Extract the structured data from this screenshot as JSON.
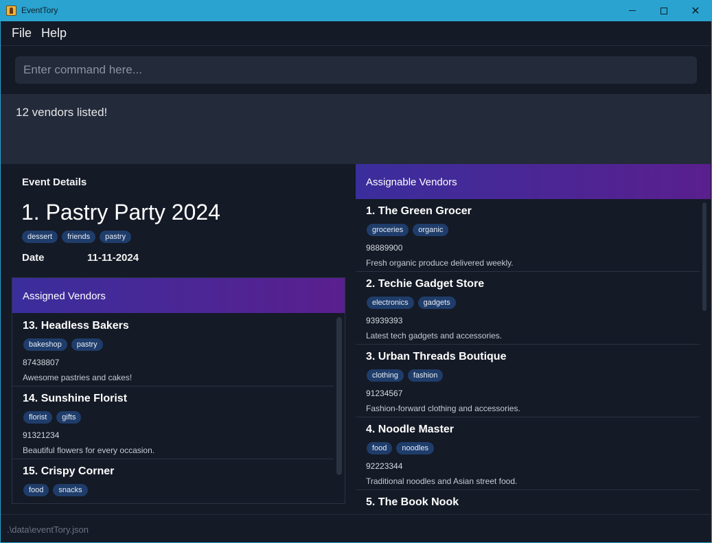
{
  "window": {
    "title": "EventTory"
  },
  "menu": {
    "file": "File",
    "help": "Help"
  },
  "command": {
    "placeholder": "Enter command here..."
  },
  "result": {
    "message": "12 vendors listed!"
  },
  "event": {
    "heading": "Event Details",
    "name": "1. Pastry Party 2024",
    "tags": [
      "dessert",
      "friends",
      "pastry"
    ],
    "date_label": "Date",
    "date_value": "11-11-2024"
  },
  "assigned": {
    "header": "Assigned Vendors",
    "vendors": [
      {
        "name": "13. Headless Bakers",
        "tags": [
          "bakeshop",
          "pastry"
        ],
        "phone": "87438807",
        "description": "Awesome pastries and cakes!"
      },
      {
        "name": "14. Sunshine Florist",
        "tags": [
          "florist",
          "gifts"
        ],
        "phone": "91321234",
        "description": "Beautiful flowers for every occasion."
      },
      {
        "name": "15. Crispy Corner",
        "tags": [
          "food",
          "snacks"
        ],
        "phone": "",
        "description": ""
      }
    ]
  },
  "assignable": {
    "header": "Assignable Vendors",
    "vendors": [
      {
        "name": "1. The Green Grocer",
        "tags": [
          "groceries",
          "organic"
        ],
        "phone": "98889900",
        "description": "Fresh organic produce delivered weekly."
      },
      {
        "name": "2. Techie Gadget Store",
        "tags": [
          "electronics",
          "gadgets"
        ],
        "phone": "93939393",
        "description": "Latest tech gadgets and accessories."
      },
      {
        "name": "3. Urban Threads Boutique",
        "tags": [
          "clothing",
          "fashion"
        ],
        "phone": "91234567",
        "description": "Fashion-forward clothing and accessories."
      },
      {
        "name": "4. Noodle Master",
        "tags": [
          "food",
          "noodles"
        ],
        "phone": "92223344",
        "description": "Traditional noodles and Asian street food."
      },
      {
        "name": "5. The Book Nook",
        "tags": [],
        "phone": "",
        "description": ""
      }
    ]
  },
  "status": {
    "path": ".\\data\\eventTory.json"
  }
}
